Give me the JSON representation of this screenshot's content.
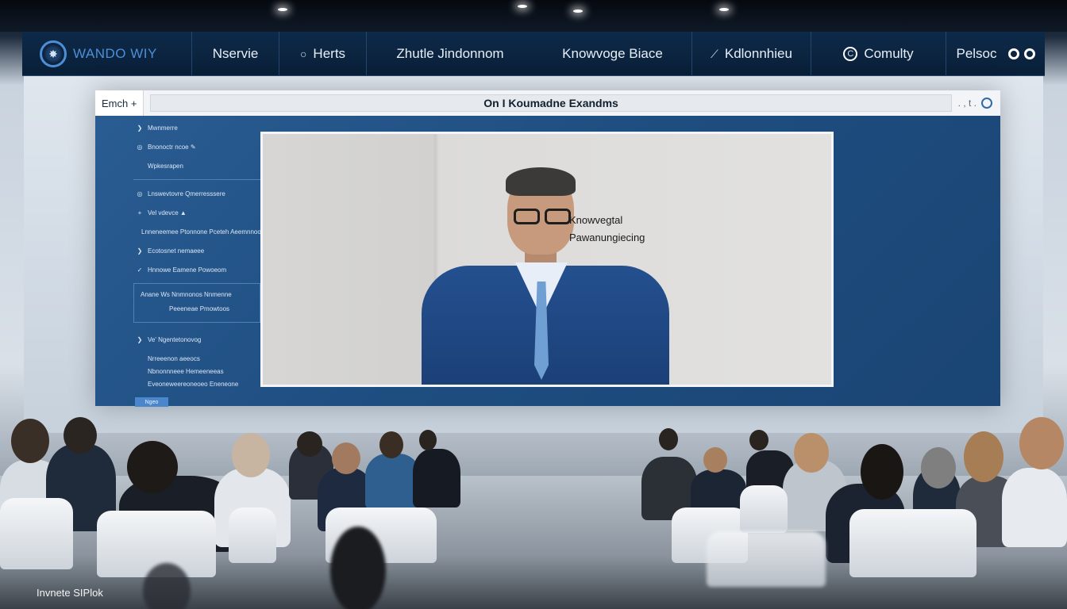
{
  "nav": {
    "logo_text": "WANDO WIY",
    "items": [
      {
        "label": "Nservie",
        "icon": "",
        "icon_name": ""
      },
      {
        "label": "Herts",
        "icon": "○",
        "icon_name": "circle-icon"
      },
      {
        "label": "Zhutle Jindonnom",
        "icon": "",
        "icon_name": ""
      },
      {
        "label": "Knowvoge Biace",
        "icon": "",
        "icon_name": ""
      },
      {
        "label": "Kdlonnhieu",
        "icon": "⟋",
        "icon_name": "pen-icon"
      },
      {
        "label": "Comulty",
        "icon": "C",
        "icon_name": "community-icon"
      },
      {
        "label": "Pelsoc",
        "icon": "",
        "icon_name": "toggle-icon"
      }
    ]
  },
  "screen": {
    "tab_label": "Emch",
    "tab_suffix": "+",
    "title": "On I Koumadne Exandms",
    "controls": ". , t ."
  },
  "sidebar": {
    "items": [
      {
        "icon": "❯",
        "label": "Mwnmerre"
      },
      {
        "icon": "◎",
        "label": "Bnonoctr ncoe  ✎"
      },
      {
        "icon": "",
        "label": "Wpkesrapen"
      },
      {
        "icon": "◎",
        "label": "Lnswevtovre Qmerresssere"
      },
      {
        "icon": "+",
        "label": "Vel  vdevce  ▲"
      },
      {
        "icon": "",
        "label": "Lnneneemee Ptonnone Pceteh Aeemnnoon"
      },
      {
        "icon": "❯",
        "label": "Ecotosnet nemaeee"
      },
      {
        "icon": "✓",
        "label": "Hnnowe Eamene Powoeom"
      },
      {
        "icon": "",
        "label": "Anane Ws Nnmnonos Nnmenne"
      },
      {
        "icon": "",
        "label": "Peeeneae Pmowtoos"
      },
      {
        "icon": "❯",
        "label": "Ve'  Ngentetonovog"
      },
      {
        "icon": "",
        "label": "Nrreeenon aeeocs"
      },
      {
        "icon": "",
        "label": "Nbnonnneee Hemeeneeas"
      },
      {
        "icon": "",
        "label": "Eveoneweereoneoeo Eneneone"
      }
    ],
    "button_label": "Ngeo"
  },
  "video": {
    "caption_line1": "Knowvegtal",
    "caption_line2": "Pawanungiecing"
  },
  "watermark": "Invnete SIPlok",
  "colors": {
    "nav_bg": "#0d2a49",
    "screen_blue": "#2a5d93",
    "suit_blue": "#24508f",
    "accent": "#4d8fd6"
  }
}
